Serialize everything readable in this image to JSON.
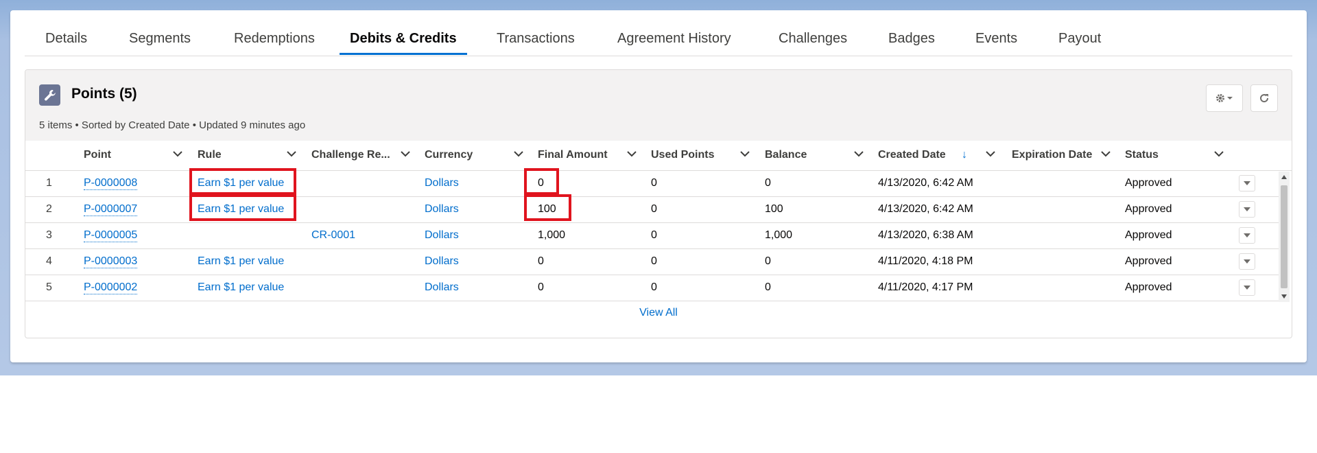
{
  "tabs": [
    {
      "label": "Details",
      "active": false
    },
    {
      "label": "Segments",
      "active": false
    },
    {
      "label": "Redemptions",
      "active": false
    },
    {
      "label": "Debits & Credits",
      "active": true
    },
    {
      "label": "Transactions",
      "active": false
    },
    {
      "label": "Agreement History",
      "active": false
    },
    {
      "label": "Challenges",
      "active": false
    },
    {
      "label": "Badges",
      "active": false
    },
    {
      "label": "Events",
      "active": false
    },
    {
      "label": "Payout",
      "active": false
    }
  ],
  "related_list": {
    "title": "Points (5)",
    "meta": "5 items • Sorted by Created Date • Updated 9 minutes ago",
    "icon": "wrench-icon",
    "settings_icon": "gear-icon",
    "refresh_icon": "refresh-icon"
  },
  "columns": [
    "Point",
    "Rule",
    "Challenge Re...",
    "Currency",
    "Final Amount",
    "Used Points",
    "Balance",
    "Created Date",
    "Expiration Date",
    "Status"
  ],
  "sort_indicator": "↓",
  "rows": [
    {
      "num": "1",
      "point": "P-0000008",
      "rule": "Earn $1 per value",
      "challenge": "",
      "currency": "Dollars",
      "final_amount": "0",
      "used_points": "0",
      "balance": "0",
      "created": "4/13/2020, 6:42 AM",
      "expiration": "",
      "status": "Approved"
    },
    {
      "num": "2",
      "point": "P-0000007",
      "rule": "Earn $1 per value",
      "challenge": "",
      "currency": "Dollars",
      "final_amount": "100",
      "used_points": "0",
      "balance": "100",
      "created": "4/13/2020, 6:42 AM",
      "expiration": "",
      "status": "Approved"
    },
    {
      "num": "3",
      "point": "P-0000005",
      "rule": "",
      "challenge": "CR-0001",
      "currency": "Dollars",
      "final_amount": "1,000",
      "used_points": "0",
      "balance": "1,000",
      "created": "4/13/2020, 6:38 AM",
      "expiration": "",
      "status": "Approved"
    },
    {
      "num": "4",
      "point": "P-0000003",
      "rule": "Earn $1 per value",
      "challenge": "",
      "currency": "Dollars",
      "final_amount": "0",
      "used_points": "0",
      "balance": "0",
      "created": "4/11/2020, 4:18 PM",
      "expiration": "",
      "status": "Approved"
    },
    {
      "num": "5",
      "point": "P-0000002",
      "rule": "Earn $1 per value",
      "challenge": "",
      "currency": "Dollars",
      "final_amount": "0",
      "used_points": "0",
      "balance": "0",
      "created": "4/11/2020, 4:17 PM",
      "expiration": "",
      "status": "Approved"
    }
  ],
  "view_all": "View All",
  "colors": {
    "link": "#006dcc",
    "active_tab_underline": "#0070d2",
    "highlight": "#e0141e"
  }
}
